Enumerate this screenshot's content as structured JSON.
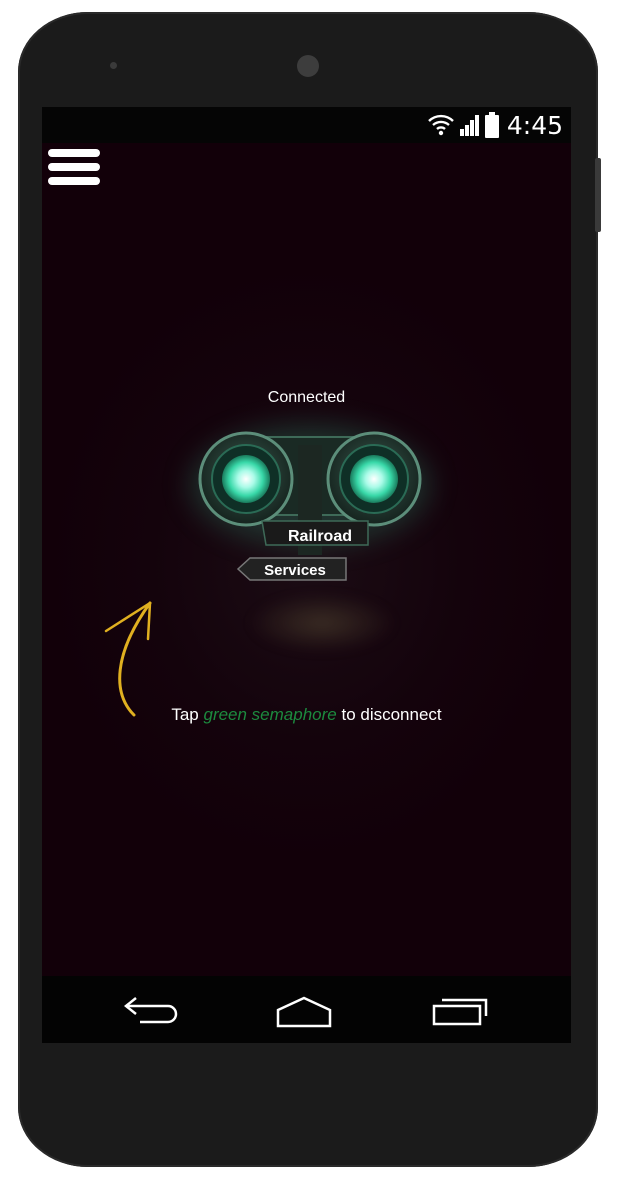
{
  "status_bar": {
    "time": "4:45",
    "icons": [
      "wifi-icon",
      "signal-icon",
      "battery-icon"
    ]
  },
  "app": {
    "menu_icon": "hamburger-menu-icon",
    "connection_status": "Connected",
    "semaphore": {
      "top_label": "Railroad",
      "bottom_label": "Services",
      "state": "green",
      "light_color": "#47f5c8"
    },
    "hint": {
      "prefix": "Tap ",
      "accent": "green semaphore",
      "suffix": " to disconnect",
      "accent_color": "#1c8a3e"
    },
    "arrow_color": "#e0b020"
  },
  "nav_bar": {
    "back_icon": "back-icon",
    "home_icon": "home-icon",
    "recents_icon": "recents-icon"
  }
}
